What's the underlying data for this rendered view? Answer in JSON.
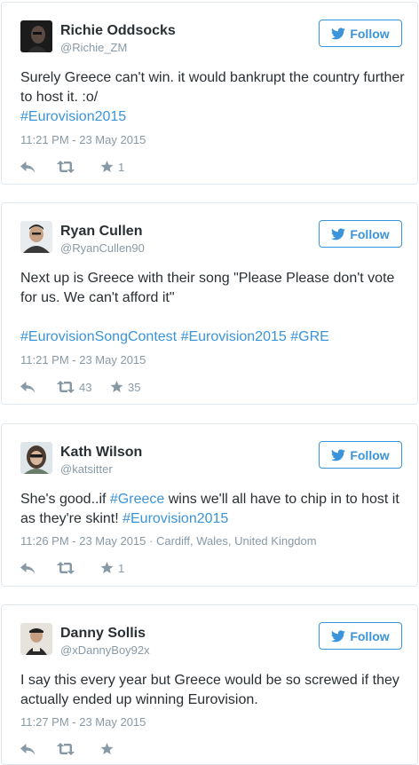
{
  "tweets": [
    {
      "name": "Richie Oddsocks",
      "handle": "@Richie_ZM",
      "follow_label": "Follow",
      "text_lines": [
        "Surely Greece can't win. it would bankrupt the country further",
        "to host it. :o/"
      ],
      "hashtag_line": "#Eurovision2015",
      "time": "11:21 PM - 23 May 2015",
      "retweets": "",
      "favorites": "1"
    },
    {
      "name": "Ryan Cullen",
      "handle": "@RyanCullen90",
      "follow_label": "Follow",
      "text_lines": [
        "Next up is Greece with their song \"Please Please don't vote",
        "for us. We can't afford it\""
      ],
      "hashtags": [
        "#EurovisionSongContest",
        "#Eurovision2015",
        "#GRE"
      ],
      "time": "11:21 PM - 23 May 2015",
      "retweets": "43",
      "favorites": "35"
    },
    {
      "name": "Kath Wilson",
      "handle": "@katsitter",
      "follow_label": "Follow",
      "text_a": "She's good..if ",
      "hashtag_a": "#Greece",
      "text_b": " wins we'll all have to chip in to host it",
      "text_c": "as they're skint! ",
      "hashtag_b": "#Eurovision2015",
      "time": "11:26 PM - 23 May 2015 · Cardiff, Wales, United Kingdom",
      "retweets": "",
      "favorites": "1"
    },
    {
      "name": "Danny Sollis",
      "handle": "@xDannyBoy92x",
      "follow_label": "Follow",
      "text_lines": [
        "I say this every year but Greece would be so screwed if they",
        "actually ended up winning Eurovision."
      ],
      "time": "11:27 PM - 23 May 2015",
      "retweets": "",
      "favorites": ""
    }
  ],
  "colors": {
    "link": "#3b94d9",
    "meta": "#8899a6",
    "text": "#292f33",
    "border": "#e1e8ed"
  },
  "icons": {
    "follow": "twitter-bird-icon",
    "reply": "reply-icon",
    "retweet": "retweet-icon",
    "favorite": "star-icon"
  }
}
